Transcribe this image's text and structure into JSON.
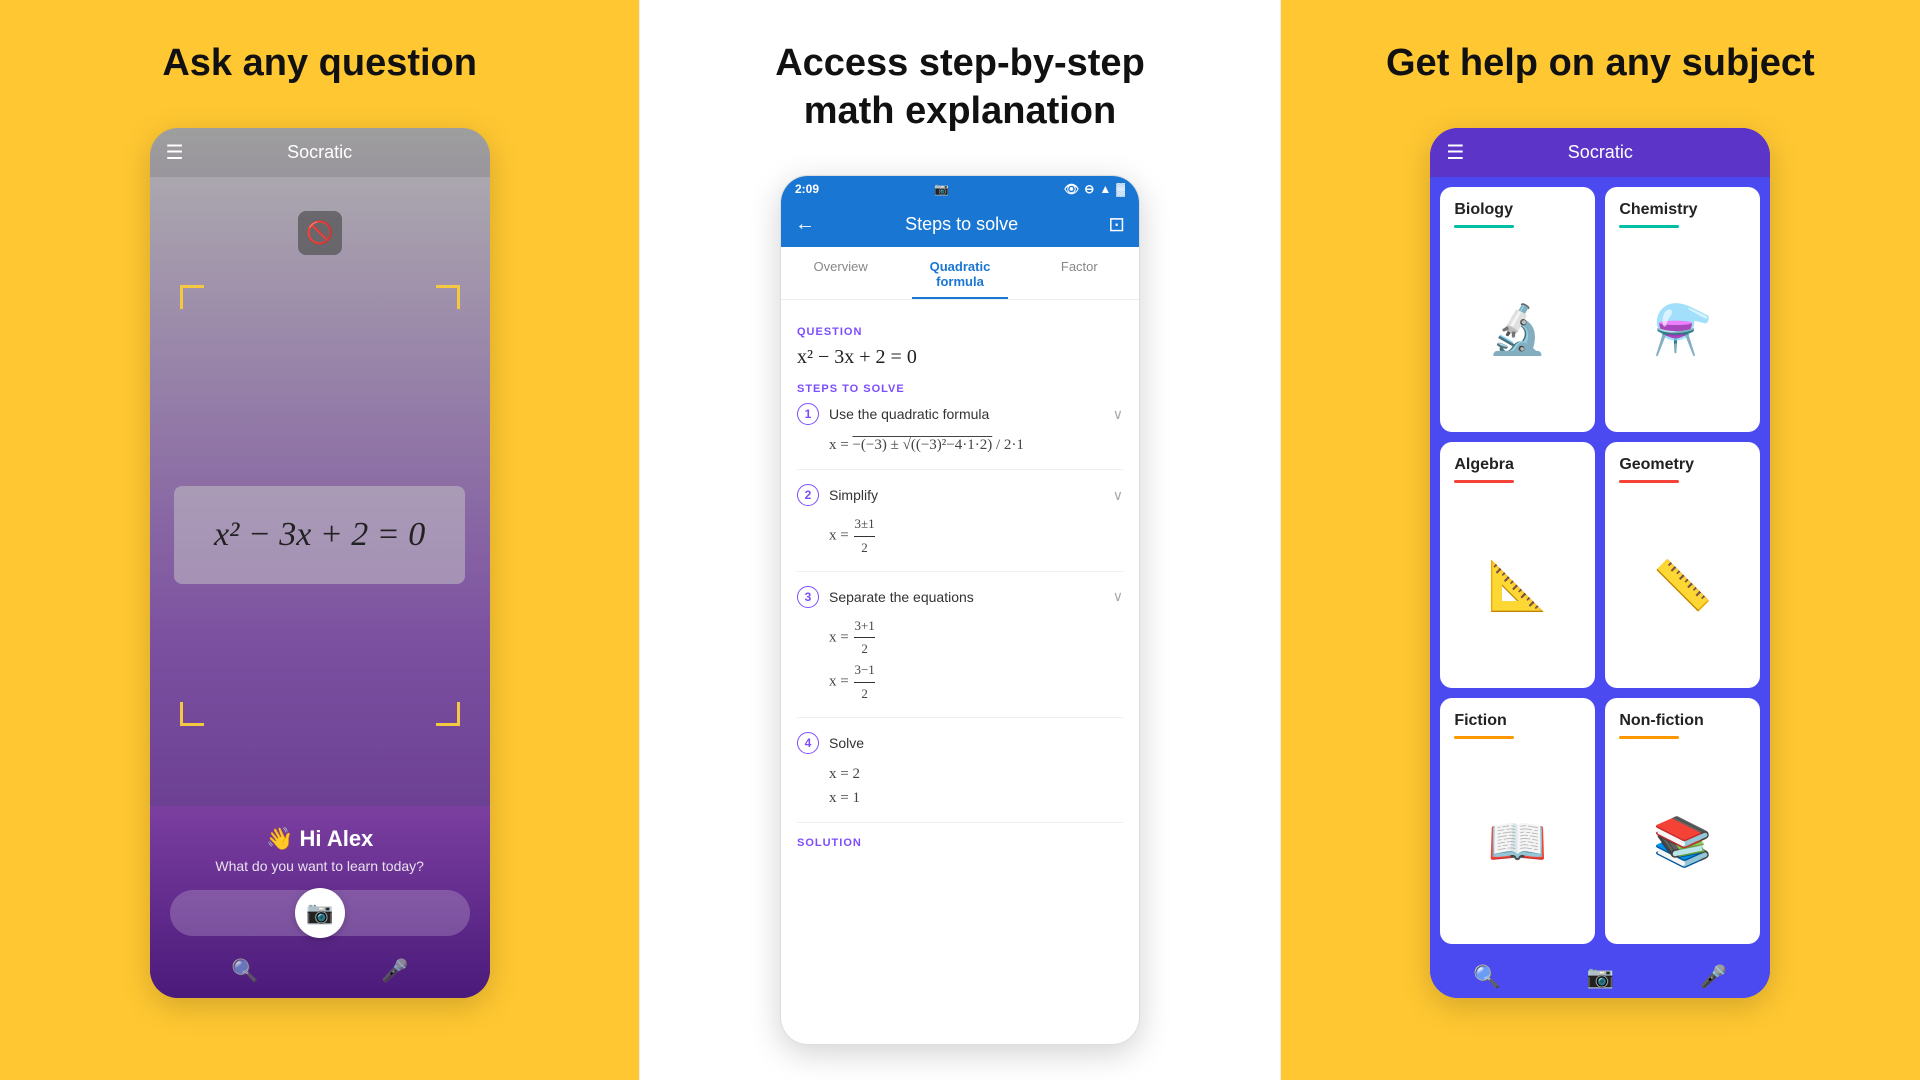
{
  "panel1": {
    "title": "Ask any question",
    "app_name": "Socratic",
    "greeting": "👋 Hi Alex",
    "greeting_sub": "What do you want to learn today?",
    "equation": "x² − 3x + 2 = 0"
  },
  "panel2": {
    "title": "Access step-by-step\nmath explanation",
    "status_time": "2:09",
    "app_bar_title": "Steps to solve",
    "tabs": [
      "Overview",
      "Quadratic formula",
      "Factor"
    ],
    "question_label": "QUESTION",
    "question_eq": "x² − 3x + 2 = 0",
    "steps_label": "STEPS TO SOLVE",
    "steps": [
      {
        "number": "1",
        "label": "Use the quadratic formula",
        "formula": "x = −(−3) ± √((−3)²−4·1·2) / 2·1"
      },
      {
        "number": "2",
        "label": "Simplify",
        "formula": "x = (3±1)/2"
      },
      {
        "number": "3",
        "label": "Separate the equations",
        "formula": "x = (3+1)/2\nx = (3−1)/2"
      },
      {
        "number": "4",
        "label": "Solve",
        "formula": "x = 2\nx = 1"
      }
    ],
    "solution_label": "SOLUTION"
  },
  "panel3": {
    "title": "Get help on any subject",
    "app_name": "Socratic",
    "subjects": [
      {
        "name": "Biology",
        "color": "teal",
        "icon": "🔬"
      },
      {
        "name": "Chemistry",
        "color": "teal",
        "icon": "⚗️"
      },
      {
        "name": "Algebra",
        "color": "red",
        "icon": "📐"
      },
      {
        "name": "Geometry",
        "color": "red",
        "icon": "📏"
      },
      {
        "name": "Fiction",
        "color": "orange",
        "icon": "📖"
      },
      {
        "name": "Non-fiction",
        "color": "orange",
        "icon": "📚"
      }
    ]
  }
}
